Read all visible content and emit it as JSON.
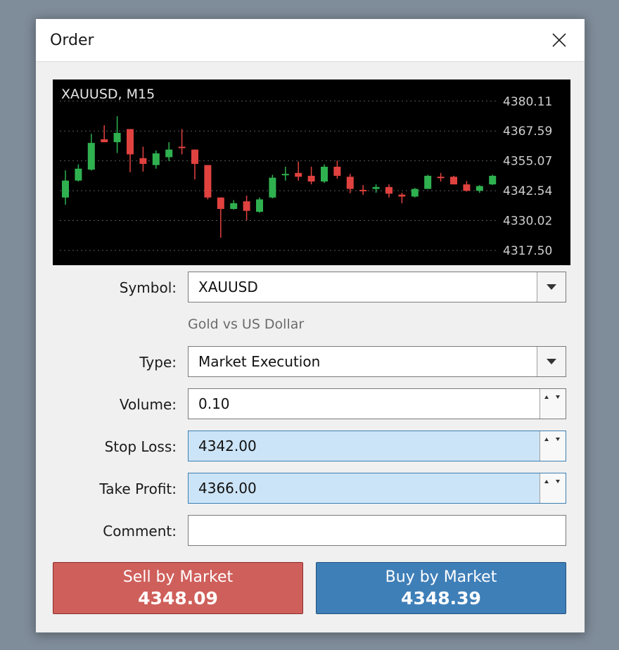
{
  "dialog": {
    "title": "Order"
  },
  "chart": {
    "symbol_label": "XAUUSD, M15",
    "price_labels": [
      "4380.11",
      "4367.59",
      "4355.07",
      "4342.54",
      "4330.02",
      "4317.50"
    ],
    "colors": {
      "bull": "#2fb150",
      "bear": "#e0423f",
      "background": "#000000",
      "grid": "#5a5a5a",
      "text": "#cfcfcf"
    }
  },
  "chart_data": {
    "type": "candlestick",
    "title": "XAUUSD, M15",
    "y_ticks": [
      4380.11,
      4367.59,
      4355.07,
      4342.54,
      4330.02,
      4317.5
    ],
    "ylim": [
      4311.3,
      4389.2
    ],
    "grid": true,
    "candles": [
      {
        "o": 4339.7,
        "h": 4351.1,
        "l": 4336.7,
        "c": 4346.8
      },
      {
        "o": 4346.8,
        "h": 4353.6,
        "l": 4346.4,
        "c": 4351.8
      },
      {
        "o": 4351.4,
        "h": 4366.4,
        "l": 4351.0,
        "c": 4362.6
      },
      {
        "o": 4364.1,
        "h": 4370.0,
        "l": 4362.9,
        "c": 4362.9
      },
      {
        "o": 4362.9,
        "h": 4373.8,
        "l": 4358.4,
        "c": 4366.8
      },
      {
        "o": 4368.4,
        "h": 4368.4,
        "l": 4350.3,
        "c": 4357.8
      },
      {
        "o": 4356.2,
        "h": 4361.0,
        "l": 4350.6,
        "c": 4353.8
      },
      {
        "o": 4353.3,
        "h": 4359.4,
        "l": 4351.8,
        "c": 4358.2
      },
      {
        "o": 4356.6,
        "h": 4362.9,
        "l": 4355.0,
        "c": 4359.8
      },
      {
        "o": 4361.0,
        "h": 4368.4,
        "l": 4357.8,
        "c": 4360.6
      },
      {
        "o": 4359.8,
        "h": 4359.8,
        "l": 4347.3,
        "c": 4353.8
      },
      {
        "o": 4353.3,
        "h": 4353.3,
        "l": 4338.9,
        "c": 4339.7
      },
      {
        "o": 4339.7,
        "h": 4339.7,
        "l": 4322.8,
        "c": 4334.9
      },
      {
        "o": 4334.9,
        "h": 4338.6,
        "l": 4334.6,
        "c": 4337.3
      },
      {
        "o": 4338.1,
        "h": 4340.5,
        "l": 4330.1,
        "c": 4334.1
      },
      {
        "o": 4333.7,
        "h": 4339.7,
        "l": 4333.3,
        "c": 4338.9
      },
      {
        "o": 4339.7,
        "h": 4349.2,
        "l": 4339.3,
        "c": 4348.0
      },
      {
        "o": 4349.2,
        "h": 4352.6,
        "l": 4346.8,
        "c": 4349.6
      },
      {
        "o": 4350.0,
        "h": 4354.8,
        "l": 4346.8,
        "c": 4348.4
      },
      {
        "o": 4348.8,
        "h": 4352.6,
        "l": 4345.2,
        "c": 4346.4
      },
      {
        "o": 4346.4,
        "h": 4353.6,
        "l": 4345.8,
        "c": 4352.6
      },
      {
        "o": 4352.6,
        "h": 4355.2,
        "l": 4347.6,
        "c": 4348.8
      },
      {
        "o": 4348.4,
        "h": 4349.6,
        "l": 4341.5,
        "c": 4343.3
      },
      {
        "o": 4342.9,
        "h": 4344.9,
        "l": 4340.8,
        "c": 4342.5
      },
      {
        "o": 4343.3,
        "h": 4345.2,
        "l": 4341.7,
        "c": 4344.1
      },
      {
        "o": 4344.1,
        "h": 4345.2,
        "l": 4339.7,
        "c": 4341.3
      },
      {
        "o": 4340.9,
        "h": 4341.7,
        "l": 4337.3,
        "c": 4340.1
      },
      {
        "o": 4340.1,
        "h": 4343.7,
        "l": 4339.7,
        "c": 4343.3
      },
      {
        "o": 4343.3,
        "h": 4349.2,
        "l": 4343.3,
        "c": 4348.8
      },
      {
        "o": 4348.4,
        "h": 4350.0,
        "l": 4346.4,
        "c": 4348.0
      },
      {
        "o": 4348.4,
        "h": 4348.8,
        "l": 4345.2,
        "c": 4345.2
      },
      {
        "o": 4345.2,
        "h": 4346.6,
        "l": 4342.2,
        "c": 4342.5
      },
      {
        "o": 4342.5,
        "h": 4344.9,
        "l": 4341.7,
        "c": 4344.5
      },
      {
        "o": 4345.2,
        "h": 4349.2,
        "l": 4344.9,
        "c": 4348.8
      }
    ]
  },
  "form": {
    "symbol": {
      "label": "Symbol:",
      "value": "XAUUSD",
      "description": "Gold vs US Dollar"
    },
    "type": {
      "label": "Type:",
      "value": "Market Execution"
    },
    "volume": {
      "label": "Volume:",
      "value": "0.10"
    },
    "stop_loss": {
      "label": "Stop Loss:",
      "value": "4342.00"
    },
    "take_profit": {
      "label": "Take Profit:",
      "value": "4366.00"
    },
    "comment": {
      "label": "Comment:",
      "value": ""
    }
  },
  "buttons": {
    "sell": {
      "label": "Sell by Market",
      "price": "4348.09",
      "color": "#cf5f5b"
    },
    "buy": {
      "label": "Buy by Market",
      "price": "4348.39",
      "color": "#3f7fb8"
    }
  },
  "icons": {
    "close": "close-icon",
    "dropdown": "chevron-down-icon",
    "spinner": "spinner-arrows-icon"
  }
}
